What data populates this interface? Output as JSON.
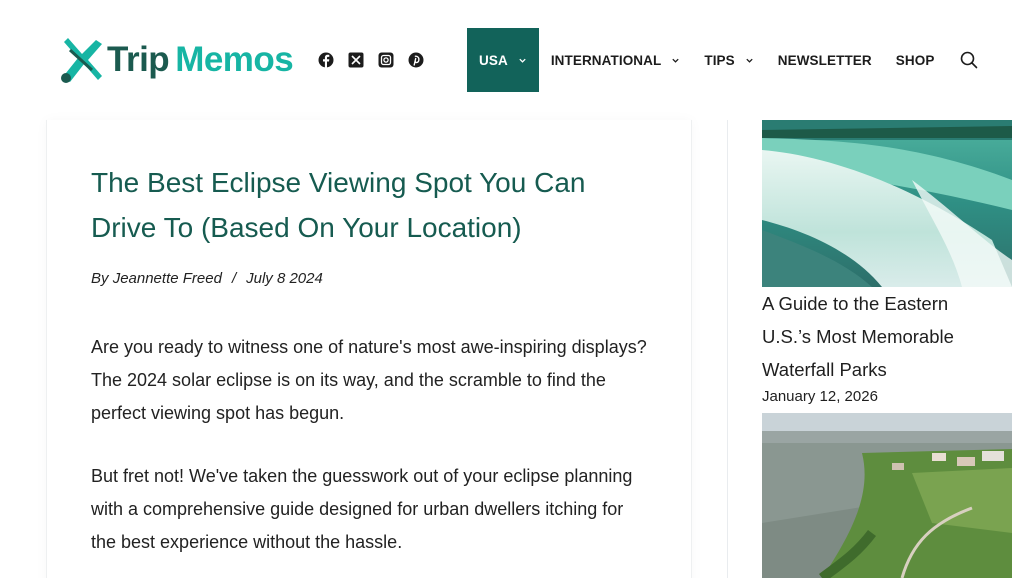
{
  "brand": {
    "word1": "Trip",
    "word2": "Memos"
  },
  "socials": [
    "facebook-icon",
    "x-twitter-icon",
    "instagram-icon",
    "pinterest-icon"
  ],
  "nav": [
    {
      "label": "USA",
      "has_dropdown": true,
      "active": true
    },
    {
      "label": "INTERNATIONAL",
      "has_dropdown": true,
      "active": false
    },
    {
      "label": "TIPS",
      "has_dropdown": true,
      "active": false
    },
    {
      "label": "NEWSLETTER",
      "has_dropdown": false,
      "active": false
    },
    {
      "label": "SHOP",
      "has_dropdown": false,
      "active": false
    }
  ],
  "article": {
    "title": "The Best Eclipse Viewing Spot You Can Drive To (Based On Your Location)",
    "author_prefix": "By",
    "author": "Jeannette Freed",
    "separator": "/",
    "date": "July 8 2024",
    "paragraphs": [
      "Are you ready to witness one of nature's most awe-inspiring displays? The 2024 solar eclipse is on its way, and the scramble to find the perfect viewing spot has begun.",
      "But fret not! We've taken the guesswork out of your eclipse planning with a comprehensive guide designed for urban dwellers itching for the best experience without the hassle."
    ]
  },
  "sidebar": {
    "posts": [
      {
        "title": "A Guide to the Eastern U.S.’s Most Memorable Waterfall Parks",
        "date": "January 12, 2026",
        "image": "waterfall-image"
      },
      {
        "title": "",
        "date": "",
        "image": "coastal-aerial-image"
      }
    ]
  },
  "colors": {
    "brand_dark": "#165b50",
    "brand_teal": "#17b5a4",
    "nav_active_bg": "#12635a"
  }
}
